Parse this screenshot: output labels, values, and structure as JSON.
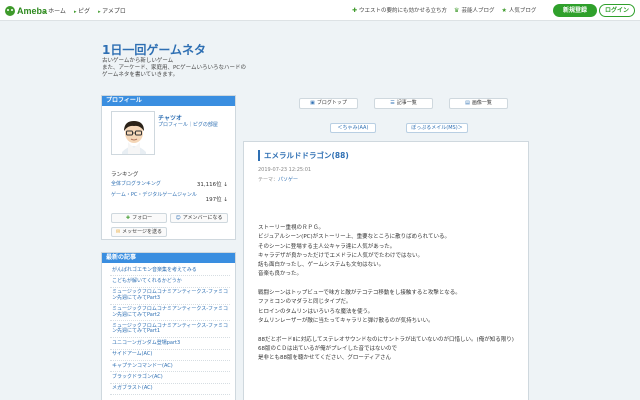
{
  "header": {
    "logo_text": "Ameba",
    "nav": [
      "ホーム",
      "ピグ",
      "アメプロ"
    ],
    "links": [
      {
        "icon": "plus-icon",
        "label": "ウエストの要約にも効かせる立ち方"
      },
      {
        "icon": "crown-icon",
        "label": "芸能人ブログ"
      },
      {
        "icon": "star-icon",
        "label": "人気ブログ"
      }
    ],
    "register_label": "新規登録",
    "login_label": "ログイン"
  },
  "blog": {
    "title": "1日一回ゲームネタ",
    "desc_lines": [
      "古いゲームから新しいゲーム",
      "また、アーケード、家庭用、PCゲームいろいろなハードの",
      "ゲームネタを書いていきます。"
    ]
  },
  "profile": {
    "heading": "プロフィール",
    "name": "チャツオ",
    "sub": "プロフィール｜ピグの部屋",
    "ranking_label": "ランキング",
    "rankings": [
      {
        "label": "全体ブログランキング",
        "value": "31,116位 ↓"
      },
      {
        "label": "ゲーム・PC・デジタルゲームジャンル",
        "value": "197位 ↓"
      }
    ],
    "follow_label": "フォロー",
    "amember_label": "アメンバーになる",
    "message_label": "メッセージを送る"
  },
  "recent": {
    "heading": "最新の記事",
    "items": [
      "がんばれゴエモン音楽集を考えてみる",
      "こどもが解いてくれるかどうか",
      "ミュージックフロムコナミアンティークス-ファミコン先週にてみてPart3",
      "ミュージックフロムコナミアンティークス-ファミコン先週にてみてPart2",
      "ミュージックフロムコナミアンティークス-ファミコン先週にてみてPart1",
      "ユニコーンガンダム登場part3",
      "サイドアーム(AC)",
      "キャプテンコマンドー(AC)",
      "ブラックドラゴン(AC)",
      "メガブラスト(AC)"
    ]
  },
  "tabs": [
    {
      "icon": "blog-icon",
      "label": "ブログトップ"
    },
    {
      "icon": "list-icon",
      "label": "記事一覧"
    },
    {
      "icon": "image-icon",
      "label": "画像一覧"
    }
  ],
  "pager": {
    "prev": "＜ちゃみ(AA)",
    "next": "ぼっぷるメイル(MS)＞"
  },
  "article": {
    "title": "エメラルドドラゴン(88)",
    "date": "2019-07-23 12:25:01",
    "theme_label": "テーマ：",
    "theme": "パソゲー",
    "paragraphs": [
      [
        "ストーリー重視のＲＰＧ。",
        "ビジュアルシーン(PC)がストーリー上、重要なところに散りばめられている。",
        "そのシーンに登場する主人公キャラ達に人気があった。",
        "キャラデザが良かっただけでエメドラに人気がでたわけではない。",
        "話も面白かったし、ゲームシステムも文句はない。",
        "音楽も良かった。"
      ],
      [
        "戦闘シーンはトップビューで味方と敵がテコテコ移動をし接触すると攻撃となる。",
        "ファミコンのマダラと同じタイプだ。",
        "ヒロインのタムリンはいろいろな魔法を使う。",
        "タムリンレーザーが敵に当たってキャラリと弾け散るのが気持ちいい。"
      ],
      [
        "88だとボードⅡに対応してステレオサウンドなのにサントラが出ていないのが口惜しい。(俺が知る限り)",
        "68版のＣＤは出ているが俺がプレイした音ではないので",
        "是非とも88版を聴かせてください、グローディアさん"
      ]
    ]
  },
  "colors": {
    "accent": "#2e6fb3",
    "brand_green": "#2fa02b",
    "sidebar_head": "#3a8ee0"
  }
}
